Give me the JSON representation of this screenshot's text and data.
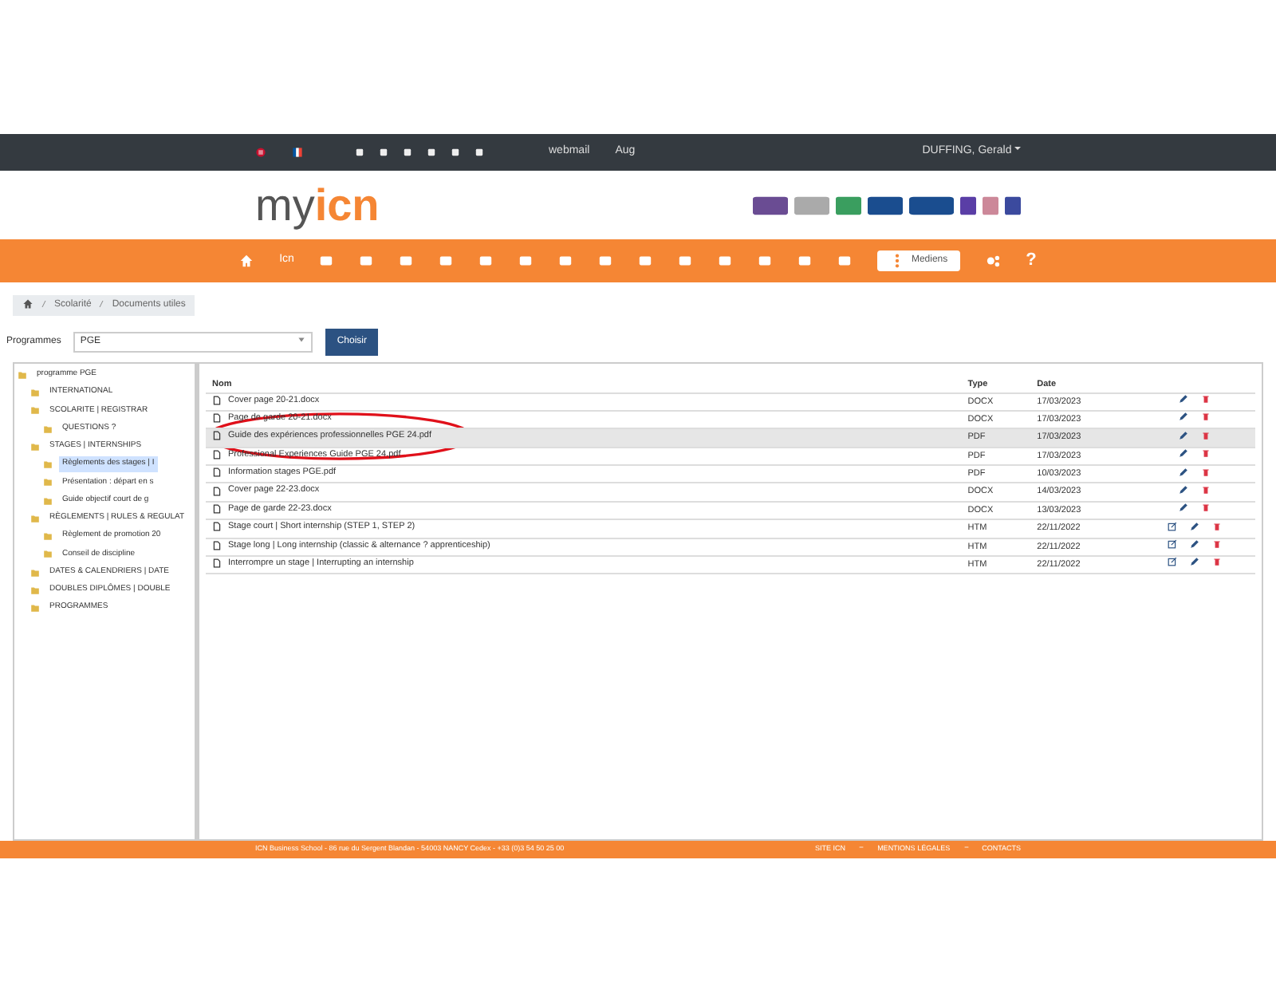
{
  "topbar": {
    "links": [
      "webmail",
      "Aug"
    ],
    "user": "DUFFING, Gerald"
  },
  "logo": {
    "part_1": "my",
    "part_2": "icn"
  },
  "nav": {
    "text_link": "Icn",
    "active": "Mediens",
    "help": "?"
  },
  "breadcrumb": [
    "Scolarité",
    "Documents utiles"
  ],
  "filter": {
    "label": "Programmes",
    "value": "PGE",
    "button": "Choisir"
  },
  "tree": [
    {
      "label": "programme PGE",
      "selected": false,
      "children": [
        {
          "label": "INTERNATIONAL",
          "selected": false
        },
        {
          "label": "SCOLARITE | REGISTRAR",
          "selected": false,
          "children": [
            {
              "label": "QUESTIONS ?",
              "selected": false
            }
          ]
        },
        {
          "label": "STAGES | INTERNSHIPS",
          "selected": false,
          "children": [
            {
              "label": "Règlements des stages | I",
              "selected": true
            },
            {
              "label": "Présentation : départ en s",
              "selected": false
            },
            {
              "label": "Guide objectif court de g",
              "selected": false
            }
          ]
        },
        {
          "label": "RÈGLEMENTS | RULES & REGULAT",
          "selected": false,
          "children": [
            {
              "label": "Règlement de promotion 20",
              "selected": false
            },
            {
              "label": "Conseil de discipline",
              "selected": false
            }
          ]
        },
        {
          "label": "DATES & CALENDRIERS | DATE",
          "selected": false
        },
        {
          "label": "DOUBLES DIPLÔMES | DOUBLE",
          "selected": false
        },
        {
          "label": "PROGRAMMES",
          "selected": false
        }
      ]
    }
  ],
  "table": {
    "columns": [
      "Nom",
      "Type",
      "Date"
    ],
    "rows": [
      {
        "name": "Cover page 20-21.docx",
        "type": "DOCX",
        "date": "17/03/2023",
        "selected": false,
        "openable": false
      },
      {
        "name": "Page de garde 20-21.docx",
        "type": "DOCX",
        "date": "17/03/2023",
        "selected": false,
        "openable": false
      },
      {
        "name": "Guide des expériences professionnelles PGE 24.pdf",
        "type": "PDF",
        "date": "17/03/2023",
        "selected": true,
        "openable": false
      },
      {
        "name": "Professional Experiences Guide PGE 24.pdf",
        "type": "PDF",
        "date": "17/03/2023",
        "selected": false,
        "openable": false
      },
      {
        "name": "Information stages PGE.pdf",
        "type": "PDF",
        "date": "10/03/2023",
        "selected": false,
        "openable": false
      },
      {
        "name": "Cover page 22-23.docx",
        "type": "DOCX",
        "date": "14/03/2023",
        "selected": false,
        "openable": false
      },
      {
        "name": "Page de garde 22-23.docx",
        "type": "DOCX",
        "date": "13/03/2023",
        "selected": false,
        "openable": false
      },
      {
        "name": "Stage court | Short internship (STEP 1, STEP 2)",
        "type": "HTM",
        "date": "22/11/2022",
        "selected": false,
        "openable": true
      },
      {
        "name": "Stage long | Long internship (classic & alternance ? apprenticeship)",
        "type": "HTM",
        "date": "22/11/2022",
        "selected": false,
        "openable": true
      },
      {
        "name": "Interrompre un stage | Interrupting an internship",
        "type": "HTM",
        "date": "22/11/2022",
        "selected": false,
        "openable": true
      }
    ]
  },
  "footer": {
    "address": "ICN Business School - 86 rue du Sergent Blandan - 54003 NANCY Cedex - +33 (0)3 54 50 25 00",
    "links": [
      "SITE ICN",
      "MENTIONS LÉGALES",
      "CONTACTS"
    ]
  }
}
